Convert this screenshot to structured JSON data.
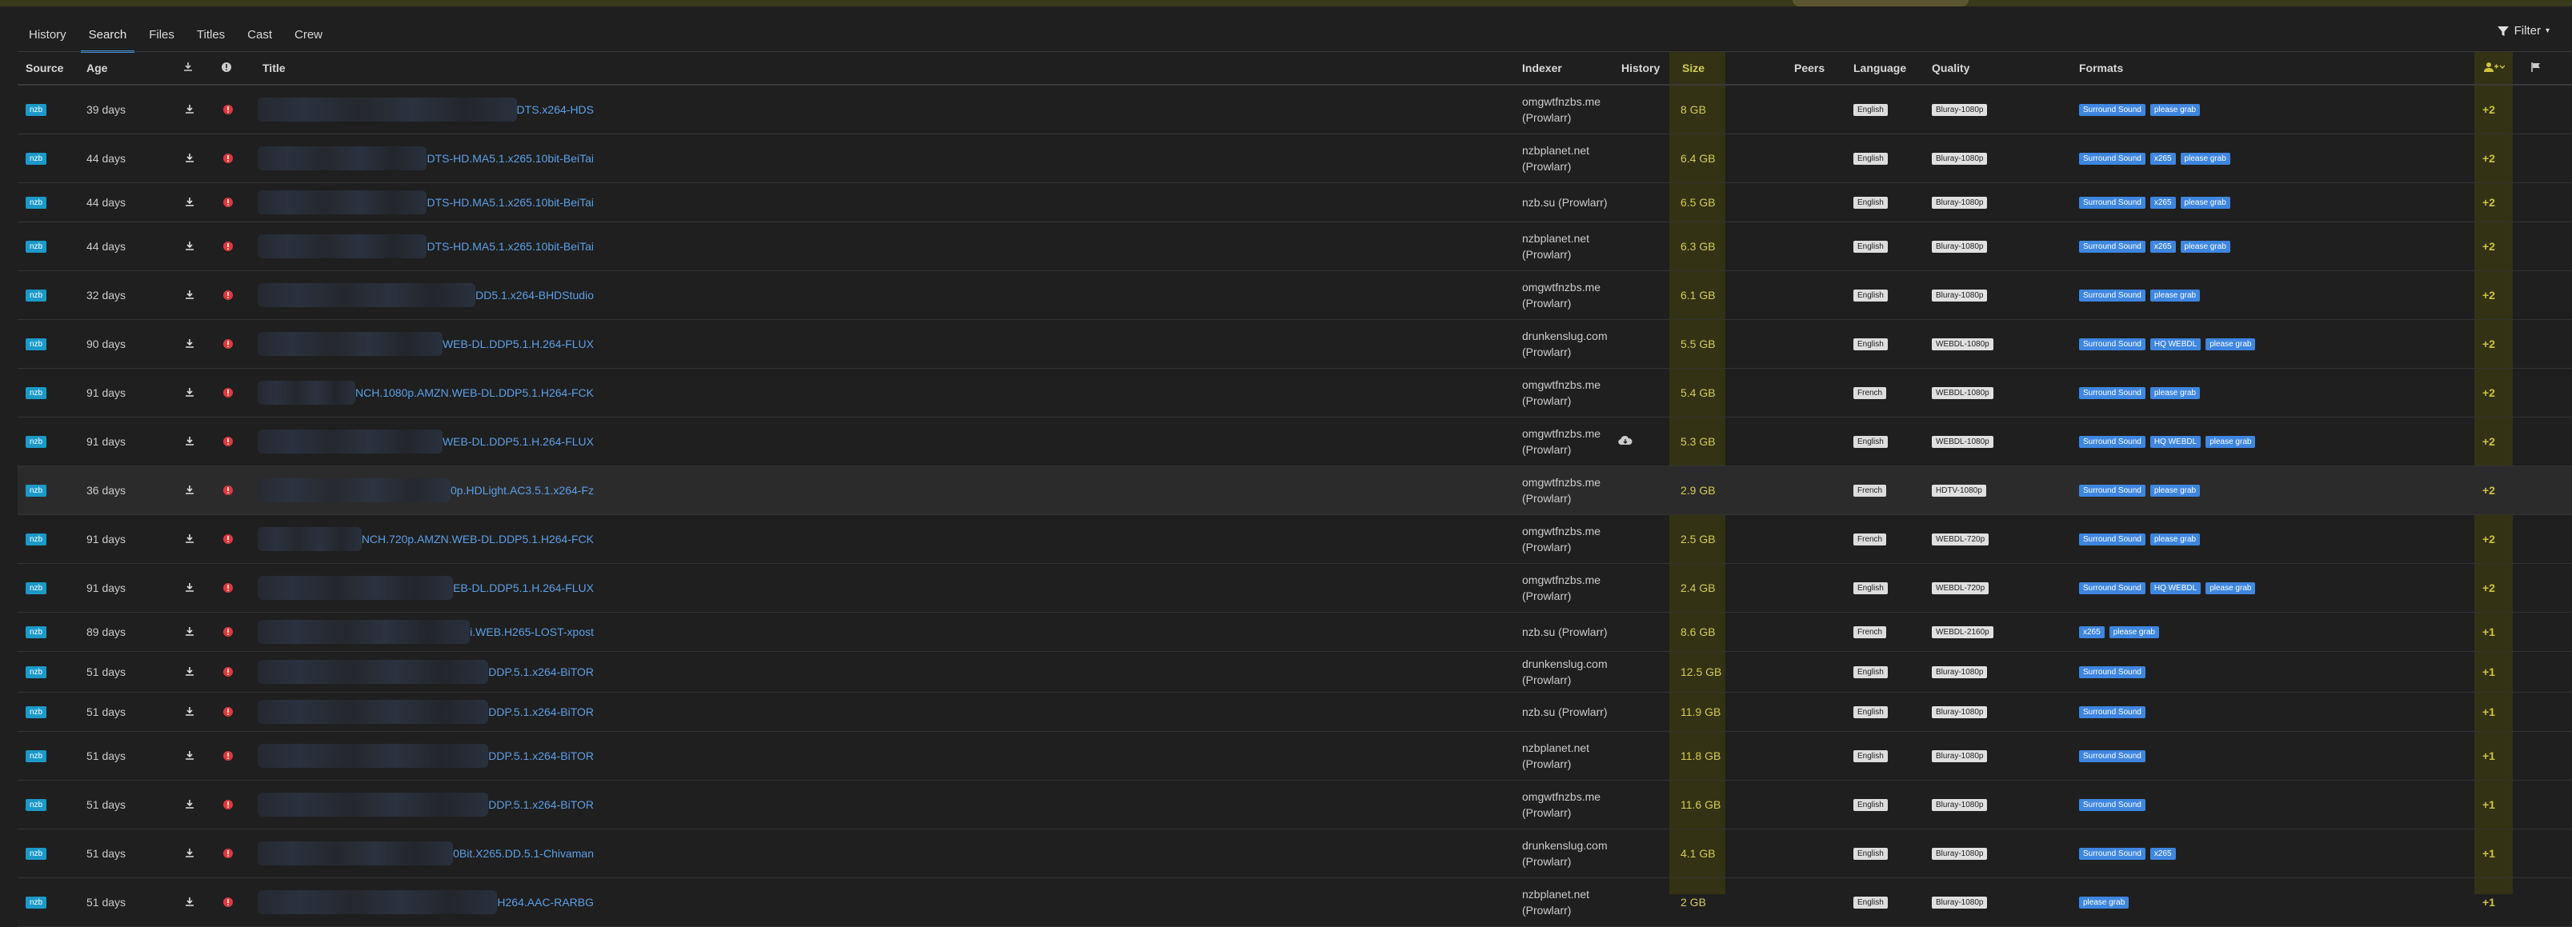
{
  "tabs": [
    "History",
    "Search",
    "Files",
    "Titles",
    "Cast",
    "Crew"
  ],
  "active_tab": "Search",
  "filter_label": "Filter",
  "colors": {
    "accent": "#3c8fd6",
    "size_text": "#d4cc55",
    "score_text": "#cfc33a",
    "nzb_badge": "#1b9ac8",
    "format_badge": "#3e86e0"
  },
  "headers": {
    "source": "Source",
    "age": "Age",
    "download_icon": "download-icon",
    "rejection_icon": "info-icon",
    "title": "Title",
    "indexer": "Indexer",
    "history": "History",
    "size": "Size",
    "peers": "Peers",
    "language": "Language",
    "quality": "Quality",
    "formats": "Formats",
    "score_icon": "user-plus-icon",
    "flag_icon": "flag-icon"
  },
  "rows": [
    {
      "source": "nzb",
      "age": "39 days",
      "title": "DTS.x264-HDS",
      "indexer1": "omgwtfnzbs.me",
      "indexer2": "(Prowlarr)",
      "size": "8 GB",
      "language": "English",
      "quality": "Bluray-1080p",
      "formats": [
        "Surround Sound",
        "please grab"
      ],
      "score": "+2",
      "h": 60
    },
    {
      "source": "nzb",
      "age": "44 days",
      "title": "DTS-HD.MA5.1.x265.10bit-BeiTai",
      "indexer1": "nzbplanet.net",
      "indexer2": "(Prowlarr)",
      "size": "6.4 GB",
      "language": "English",
      "quality": "Bluray-1080p",
      "formats": [
        "Surround Sound",
        "x265",
        "please grab"
      ],
      "score": "+2",
      "h": 60
    },
    {
      "source": "nzb",
      "age": "44 days",
      "title": "DTS-HD.MA5.1.x265.10bit-BeiTai",
      "indexer1": "nzb.su (Prowlarr)",
      "indexer2": "",
      "size": "6.5 GB",
      "language": "English",
      "quality": "Bluray-1080p",
      "formats": [
        "Surround Sound",
        "x265",
        "please grab"
      ],
      "score": "+2",
      "h": 48
    },
    {
      "source": "nzb",
      "age": "44 days",
      "title": "DTS-HD.MA5.1.x265.10bit-BeiTai",
      "indexer1": "nzbplanet.net",
      "indexer2": "(Prowlarr)",
      "size": "6.3 GB",
      "language": "English",
      "quality": "Bluray-1080p",
      "formats": [
        "Surround Sound",
        "x265",
        "please grab"
      ],
      "score": "+2",
      "h": 60
    },
    {
      "source": "nzb",
      "age": "32 days",
      "title": "DD5.1.x264-BHDStudio",
      "indexer1": "omgwtfnzbs.me",
      "indexer2": "(Prowlarr)",
      "size": "6.1 GB",
      "language": "English",
      "quality": "Bluray-1080p",
      "formats": [
        "Surround Sound",
        "please grab"
      ],
      "score": "+2",
      "h": 60
    },
    {
      "source": "nzb",
      "age": "90 days",
      "title": "WEB-DL.DDP5.1.H.264-FLUX",
      "indexer1": "drunkenslug.com",
      "indexer2": "(Prowlarr)",
      "size": "5.5 GB",
      "language": "English",
      "quality": "WEBDL-1080p",
      "formats": [
        "Surround Sound",
        "HQ WEBDL",
        "please grab"
      ],
      "score": "+2",
      "h": 60
    },
    {
      "source": "nzb",
      "age": "91 days",
      "title": "NCH.1080p.AMZN.WEB-DL.DDP5.1.H264-FCK",
      "indexer1": "omgwtfnzbs.me",
      "indexer2": "(Prowlarr)",
      "size": "5.4 GB",
      "language": "French",
      "quality": "WEBDL-1080p",
      "formats": [
        "Surround Sound",
        "please grab"
      ],
      "score": "+2",
      "h": 60
    },
    {
      "source": "nzb",
      "age": "91 days",
      "title": "WEB-DL.DDP5.1.H.264-FLUX",
      "indexer1": "omgwtfnzbs.me",
      "indexer2": "(Prowlarr)",
      "size": "5.3 GB",
      "language": "English",
      "quality": "WEBDL-1080p",
      "formats": [
        "Surround Sound",
        "HQ WEBDL",
        "please grab"
      ],
      "score": "+2",
      "h": 60,
      "history": true
    },
    {
      "source": "nzb",
      "age": "36 days",
      "title": "0p.HDLight.AC3.5.1.x264-Fz",
      "indexer1": "omgwtfnzbs.me",
      "indexer2": "(Prowlarr)",
      "size": "2.9 GB",
      "language": "French",
      "quality": "HDTV-1080p",
      "formats": [
        "Surround Sound",
        "please grab"
      ],
      "score": "+2",
      "h": 60,
      "hl": true
    },
    {
      "source": "nzb",
      "age": "91 days",
      "title": "NCH.720p.AMZN.WEB-DL.DDP5.1.H264-FCK",
      "indexer1": "omgwtfnzbs.me",
      "indexer2": "(Prowlarr)",
      "size": "2.5 GB",
      "language": "French",
      "quality": "WEBDL-720p",
      "formats": [
        "Surround Sound",
        "please grab"
      ],
      "score": "+2",
      "h": 60
    },
    {
      "source": "nzb",
      "age": "91 days",
      "title": "EB-DL.DDP5.1.H.264-FLUX",
      "indexer1": "omgwtfnzbs.me",
      "indexer2": "(Prowlarr)",
      "size": "2.4 GB",
      "language": "English",
      "quality": "WEBDL-720p",
      "formats": [
        "Surround Sound",
        "HQ WEBDL",
        "please grab"
      ],
      "score": "+2",
      "h": 60
    },
    {
      "source": "nzb",
      "age": "89 days",
      "title": "i.WEB.H265-LOST-xpost",
      "indexer1": "nzb.su (Prowlarr)",
      "indexer2": "",
      "size": "8.6 GB",
      "language": "French",
      "quality": "WEBDL-2160p",
      "formats": [
        "x265",
        "please grab"
      ],
      "score": "+1",
      "h": 48
    },
    {
      "source": "nzb",
      "age": "51 days",
      "title": "DDP.5.1.x264-BiTOR",
      "indexer1": "drunkenslug.com",
      "indexer2": "(Prowlarr)",
      "size": "12.5 GB",
      "language": "English",
      "quality": "Bluray-1080p",
      "formats": [
        "Surround Sound"
      ],
      "score": "+1",
      "h": 50
    },
    {
      "source": "nzb",
      "age": "51 days",
      "title": "DDP.5.1.x264-BiTOR",
      "indexer1": "nzb.su (Prowlarr)",
      "indexer2": "",
      "size": "11.9 GB",
      "language": "English",
      "quality": "Bluray-1080p",
      "formats": [
        "Surround Sound"
      ],
      "score": "+1",
      "h": 48
    },
    {
      "source": "nzb",
      "age": "51 days",
      "title": "DDP.5.1.x264-BiTOR",
      "indexer1": "nzbplanet.net",
      "indexer2": "(Prowlarr)",
      "size": "11.8 GB",
      "language": "English",
      "quality": "Bluray-1080p",
      "formats": [
        "Surround Sound"
      ],
      "score": "+1",
      "h": 60
    },
    {
      "source": "nzb",
      "age": "51 days",
      "title": "DDP.5.1.x264-BiTOR",
      "indexer1": "omgwtfnzbs.me",
      "indexer2": "(Prowlarr)",
      "size": "11.6 GB",
      "language": "English",
      "quality": "Bluray-1080p",
      "formats": [
        "Surround Sound"
      ],
      "score": "+1",
      "h": 60
    },
    {
      "source": "nzb",
      "age": "51 days",
      "title": "0Bit.X265.DD.5.1-Chivaman",
      "indexer1": "drunkenslug.com",
      "indexer2": "(Prowlarr)",
      "size": "4.1 GB",
      "language": "English",
      "quality": "Bluray-1080p",
      "formats": [
        "Surround Sound",
        "x265"
      ],
      "score": "+1",
      "h": 60
    },
    {
      "source": "nzb",
      "age": "51 days",
      "title": "H264.AAC-RARBG",
      "indexer1": "nzbplanet.net",
      "indexer2": "(Prowlarr)",
      "size": "2 GB",
      "language": "English",
      "quality": "Bluray-1080p",
      "formats": [
        "please grab"
      ],
      "score": "+1",
      "h": 60
    }
  ]
}
